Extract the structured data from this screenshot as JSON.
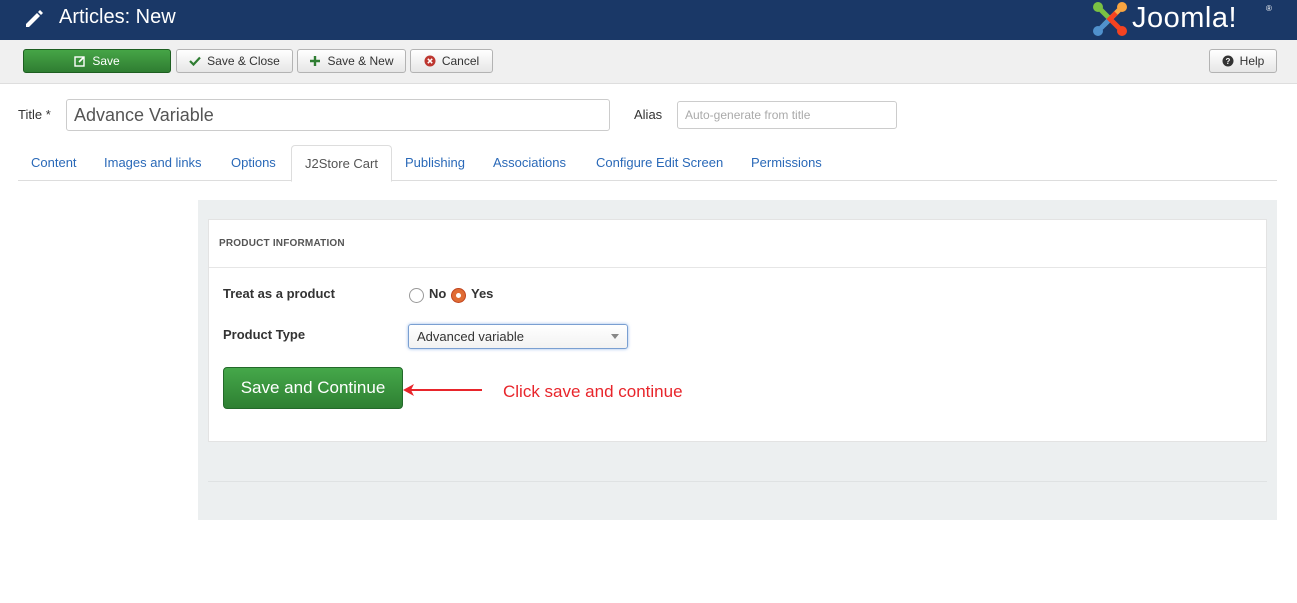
{
  "header": {
    "page_title": "Articles: New",
    "logo_text": "Joomla!",
    "logo_reg": "®"
  },
  "toolbar": {
    "save": "Save",
    "save_close": "Save & Close",
    "save_new": "Save & New",
    "cancel": "Cancel",
    "help": "Help"
  },
  "form": {
    "title_label": "Title *",
    "title_value": "Advance Variable",
    "alias_label": "Alias",
    "alias_placeholder": "Auto-generate from title"
  },
  "tabs": [
    {
      "label": "Content"
    },
    {
      "label": "Images and links"
    },
    {
      "label": "Options"
    },
    {
      "label": "J2Store Cart",
      "active": true
    },
    {
      "label": "Publishing"
    },
    {
      "label": "Associations"
    },
    {
      "label": "Configure Edit Screen"
    },
    {
      "label": "Permissions"
    }
  ],
  "product": {
    "section_title": "PRODUCT INFORMATION",
    "treat_label": "Treat as a product",
    "no_label": "No",
    "yes_label": "Yes",
    "treat_selected": "Yes",
    "type_label": "Product Type",
    "type_value": "Advanced variable",
    "save_continue": "Save and Continue"
  },
  "annotation": {
    "text": "Click save and continue",
    "color": "#e8252b"
  },
  "colors": {
    "header_bg": "#1a3867",
    "save_green": "#3a943c",
    "link_blue": "#2a69b8"
  }
}
